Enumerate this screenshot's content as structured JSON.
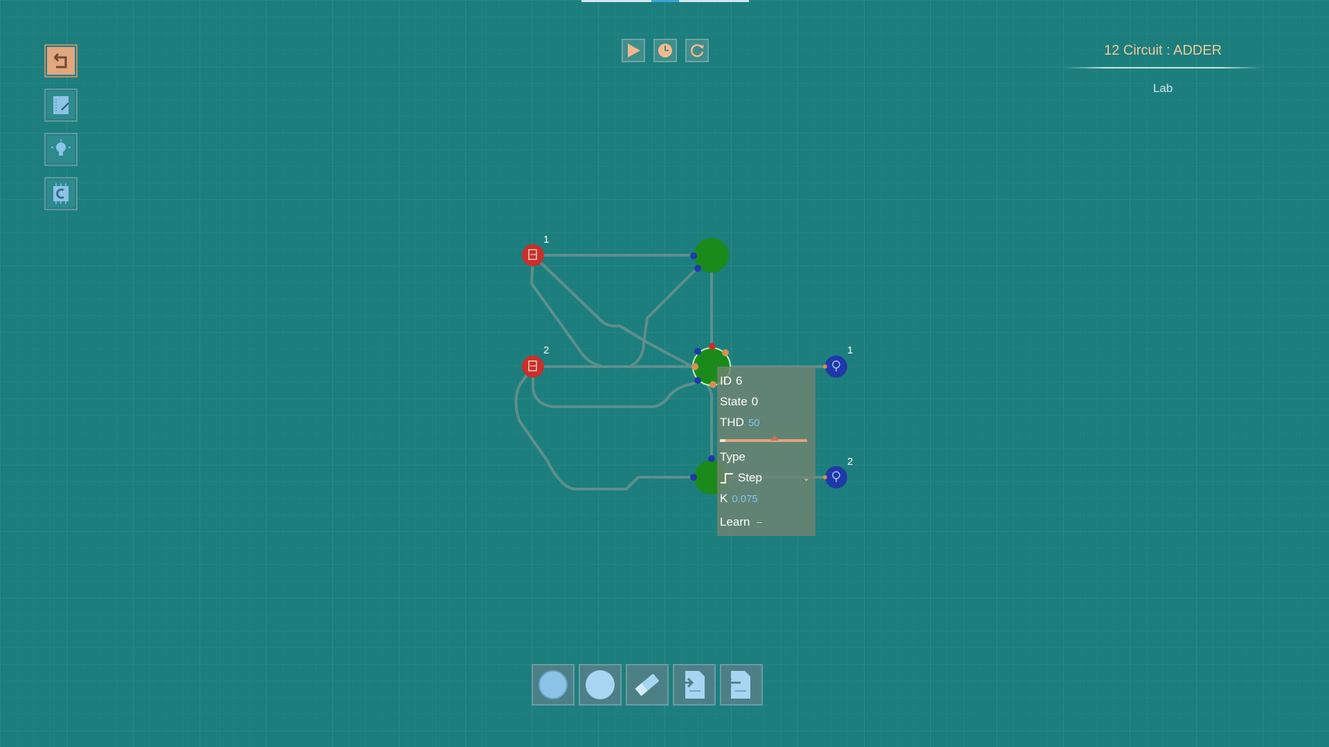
{
  "top_indicator": {
    "active_index": 1
  },
  "side_toolbar": [
    {
      "name": "back",
      "icon": "back-arrow-icon"
    },
    {
      "name": "notebook",
      "icon": "notebook-icon"
    },
    {
      "name": "hint",
      "icon": "lightbulb-icon"
    },
    {
      "name": "chip",
      "icon": "chip-icon"
    }
  ],
  "playbar": [
    {
      "name": "play",
      "icon": "play-icon"
    },
    {
      "name": "step",
      "icon": "clock-icon"
    },
    {
      "name": "reset",
      "icon": "refresh-icon"
    }
  ],
  "level": {
    "title": "12 Circuit : ADDER",
    "subtitle": "Lab"
  },
  "circuit": {
    "inputs": [
      {
        "label": "1"
      },
      {
        "label": "2"
      }
    ],
    "outputs": [
      {
        "label": "1"
      },
      {
        "label": "2"
      }
    ],
    "colors": {
      "input": "#c8302c",
      "neuron": "#1a8a1a",
      "output": "#1f3aa8",
      "wire": "#5f8f8c"
    }
  },
  "inspector": {
    "id_label": "ID",
    "id_value": "6",
    "state_label": "State",
    "state_value": "0",
    "thd_label": "THD",
    "thd_value": "50",
    "thd_slider_fraction": 0.63,
    "type_label": "Type",
    "type_value": "Step",
    "k_label": "K",
    "k_value": "0.075",
    "learn_label": "Learn"
  },
  "bottom_toolbar": [
    {
      "name": "neuron-tool",
      "icon": "neuron-circle-icon"
    },
    {
      "name": "node-tool",
      "icon": "circle-icon"
    },
    {
      "name": "eraser-tool",
      "icon": "eraser-icon"
    },
    {
      "name": "input-doc-tool",
      "icon": "document-input-icon"
    },
    {
      "name": "output-doc-tool",
      "icon": "document-output-icon"
    }
  ]
}
